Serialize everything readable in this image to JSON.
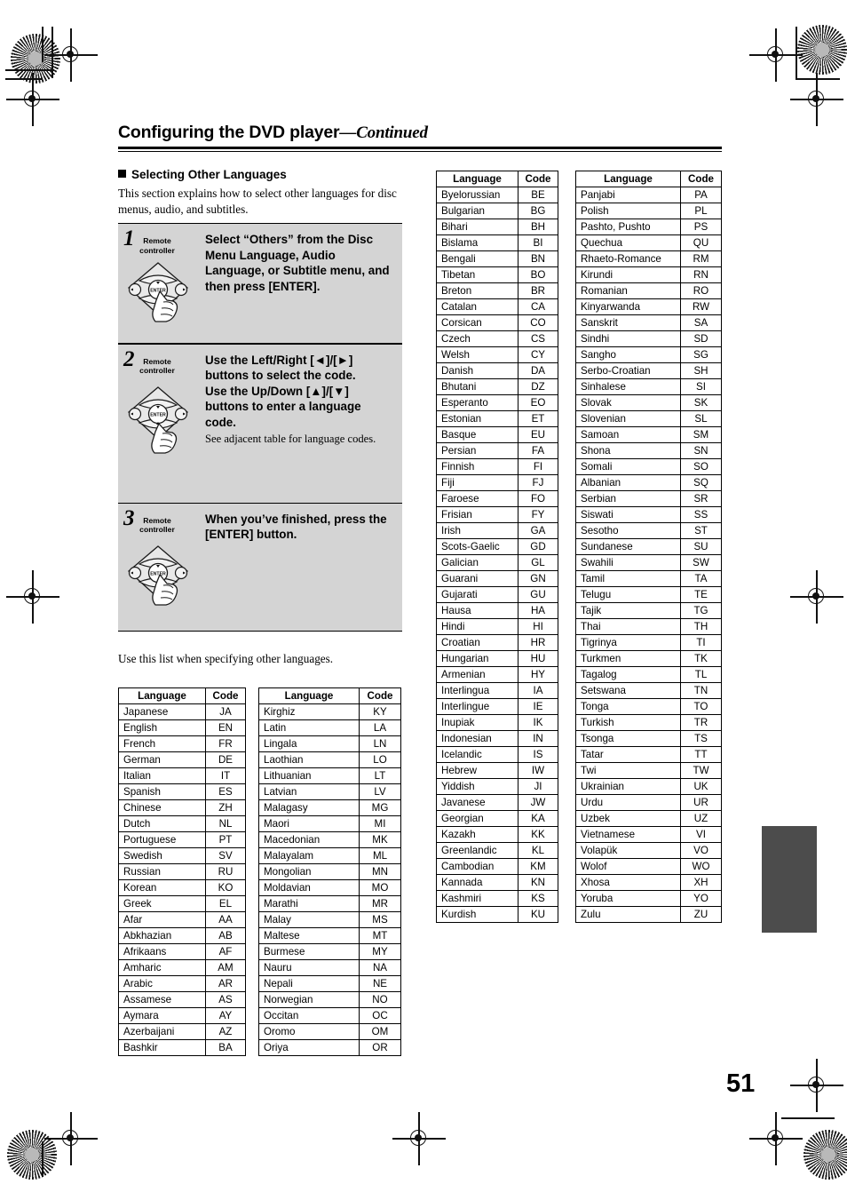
{
  "document": {
    "title_main": "Configuring the DVD player",
    "title_continued": "—Continued",
    "page_number": "51"
  },
  "section": {
    "heading": "Selecting Other Languages",
    "intro": "This section explains how to select other languages for disc menus, audio, and subtitles.",
    "list_intro": "Use this list when specifying other languages."
  },
  "steps": [
    {
      "number": "1",
      "device_label": "Remote\ncontroller",
      "title": "Select “Others” from the Disc Menu Language, Audio Language, or Subtitle menu, and then press [ENTER].",
      "note": "",
      "pressed_button": "enter"
    },
    {
      "number": "2",
      "device_label": "Remote\ncontroller",
      "title": "Use the Left/Right [◄]/[►] buttons to select the code.\nUse the Up/Down [▲]/[▼] buttons to enter a language code.",
      "note": "See adjacent table for language codes.",
      "pressed_button": "down"
    },
    {
      "number": "3",
      "device_label": "Remote\ncontroller",
      "title": "When you’ve finished, press the [ENTER] button.",
      "note": "",
      "pressed_button": "enter"
    }
  ],
  "tables": {
    "headers": {
      "language": "Language",
      "code": "Code"
    },
    "col1": [
      [
        "Japanese",
        "JA"
      ],
      [
        "English",
        "EN"
      ],
      [
        "French",
        "FR"
      ],
      [
        "German",
        "DE"
      ],
      [
        "Italian",
        "IT"
      ],
      [
        "Spanish",
        "ES"
      ],
      [
        "Chinese",
        "ZH"
      ],
      [
        "Dutch",
        "NL"
      ],
      [
        "Portuguese",
        "PT"
      ],
      [
        "Swedish",
        "SV"
      ],
      [
        "Russian",
        "RU"
      ],
      [
        "Korean",
        "KO"
      ],
      [
        "Greek",
        "EL"
      ],
      [
        "Afar",
        "AA"
      ],
      [
        "Abkhazian",
        "AB"
      ],
      [
        "Afrikaans",
        "AF"
      ],
      [
        "Amharic",
        "AM"
      ],
      [
        "Arabic",
        "AR"
      ],
      [
        "Assamese",
        "AS"
      ],
      [
        "Aymara",
        "AY"
      ],
      [
        "Azerbaijani",
        "AZ"
      ],
      [
        "Bashkir",
        "BA"
      ]
    ],
    "col2": [
      [
        "Kirghiz",
        "KY"
      ],
      [
        "Latin",
        "LA"
      ],
      [
        "Lingala",
        "LN"
      ],
      [
        "Laothian",
        "LO"
      ],
      [
        "Lithuanian",
        "LT"
      ],
      [
        "Latvian",
        "LV"
      ],
      [
        "Malagasy",
        "MG"
      ],
      [
        "Maori",
        "MI"
      ],
      [
        "Macedonian",
        "MK"
      ],
      [
        "Malayalam",
        "ML"
      ],
      [
        "Mongolian",
        "MN"
      ],
      [
        "Moldavian",
        "MO"
      ],
      [
        "Marathi",
        "MR"
      ],
      [
        "Malay",
        "MS"
      ],
      [
        "Maltese",
        "MT"
      ],
      [
        "Burmese",
        "MY"
      ],
      [
        "Nauru",
        "NA"
      ],
      [
        "Nepali",
        "NE"
      ],
      [
        "Norwegian",
        "NO"
      ],
      [
        "Occitan",
        "OC"
      ],
      [
        "Oromo",
        "OM"
      ],
      [
        "Oriya",
        "OR"
      ]
    ],
    "col3": [
      [
        "Byelorussian",
        "BE"
      ],
      [
        "Bulgarian",
        "BG"
      ],
      [
        "Bihari",
        "BH"
      ],
      [
        "Bislama",
        "BI"
      ],
      [
        "Bengali",
        "BN"
      ],
      [
        "Tibetan",
        "BO"
      ],
      [
        "Breton",
        "BR"
      ],
      [
        "Catalan",
        "CA"
      ],
      [
        "Corsican",
        "CO"
      ],
      [
        "Czech",
        "CS"
      ],
      [
        "Welsh",
        "CY"
      ],
      [
        "Danish",
        "DA"
      ],
      [
        "Bhutani",
        "DZ"
      ],
      [
        "Esperanto",
        "EO"
      ],
      [
        "Estonian",
        "ET"
      ],
      [
        "Basque",
        "EU"
      ],
      [
        "Persian",
        "FA"
      ],
      [
        "Finnish",
        "FI"
      ],
      [
        "Fiji",
        "FJ"
      ],
      [
        "Faroese",
        "FO"
      ],
      [
        "Frisian",
        "FY"
      ],
      [
        "Irish",
        "GA"
      ],
      [
        "Scots-Gaelic",
        "GD"
      ],
      [
        "Galician",
        "GL"
      ],
      [
        "Guarani",
        "GN"
      ],
      [
        "Gujarati",
        "GU"
      ],
      [
        "Hausa",
        "HA"
      ],
      [
        "Hindi",
        "HI"
      ],
      [
        "Croatian",
        "HR"
      ],
      [
        "Hungarian",
        "HU"
      ],
      [
        "Armenian",
        "HY"
      ],
      [
        "Interlingua",
        "IA"
      ],
      [
        "Interlingue",
        "IE"
      ],
      [
        "Inupiak",
        "IK"
      ],
      [
        "Indonesian",
        "IN"
      ],
      [
        "Icelandic",
        "IS"
      ],
      [
        "Hebrew",
        "IW"
      ],
      [
        "Yiddish",
        "JI"
      ],
      [
        "Javanese",
        "JW"
      ],
      [
        "Georgian",
        "KA"
      ],
      [
        "Kazakh",
        "KK"
      ],
      [
        "Greenlandic",
        "KL"
      ],
      [
        "Cambodian",
        "KM"
      ],
      [
        "Kannada",
        "KN"
      ],
      [
        "Kashmiri",
        "KS"
      ],
      [
        "Kurdish",
        "KU"
      ]
    ],
    "col4": [
      [
        "Panjabi",
        "PA"
      ],
      [
        "Polish",
        "PL"
      ],
      [
        "Pashto, Pushto",
        "PS"
      ],
      [
        "Quechua",
        "QU"
      ],
      [
        "Rhaeto-Romance",
        "RM"
      ],
      [
        "Kirundi",
        "RN"
      ],
      [
        "Romanian",
        "RO"
      ],
      [
        "Kinyarwanda",
        "RW"
      ],
      [
        "Sanskrit",
        "SA"
      ],
      [
        "Sindhi",
        "SD"
      ],
      [
        "Sangho",
        "SG"
      ],
      [
        "Serbo-Croatian",
        "SH"
      ],
      [
        "Sinhalese",
        "SI"
      ],
      [
        "Slovak",
        "SK"
      ],
      [
        "Slovenian",
        "SL"
      ],
      [
        "Samoan",
        "SM"
      ],
      [
        "Shona",
        "SN"
      ],
      [
        "Somali",
        "SO"
      ],
      [
        "Albanian",
        "SQ"
      ],
      [
        "Serbian",
        "SR"
      ],
      [
        "Siswati",
        "SS"
      ],
      [
        "Sesotho",
        "ST"
      ],
      [
        "Sundanese",
        "SU"
      ],
      [
        "Swahili",
        "SW"
      ],
      [
        "Tamil",
        "TA"
      ],
      [
        "Telugu",
        "TE"
      ],
      [
        "Tajik",
        "TG"
      ],
      [
        "Thai",
        "TH"
      ],
      [
        "Tigrinya",
        "TI"
      ],
      [
        "Turkmen",
        "TK"
      ],
      [
        "Tagalog",
        "TL"
      ],
      [
        "Setswana",
        "TN"
      ],
      [
        "Tonga",
        "TO"
      ],
      [
        "Turkish",
        "TR"
      ],
      [
        "Tsonga",
        "TS"
      ],
      [
        "Tatar",
        "TT"
      ],
      [
        "Twi",
        "TW"
      ],
      [
        "Ukrainian",
        "UK"
      ],
      [
        "Urdu",
        "UR"
      ],
      [
        "Uzbek",
        "UZ"
      ],
      [
        "Vietnamese",
        "VI"
      ],
      [
        "Volapük",
        "VO"
      ],
      [
        "Wolof",
        "WO"
      ],
      [
        "Xhosa",
        "XH"
      ],
      [
        "Yoruba",
        "YO"
      ],
      [
        "Zulu",
        "ZU"
      ]
    ]
  },
  "colors": {
    "step_panel": "#d4d4d4",
    "thumb_tab": "#4c4c4c",
    "ink": "#000000"
  }
}
